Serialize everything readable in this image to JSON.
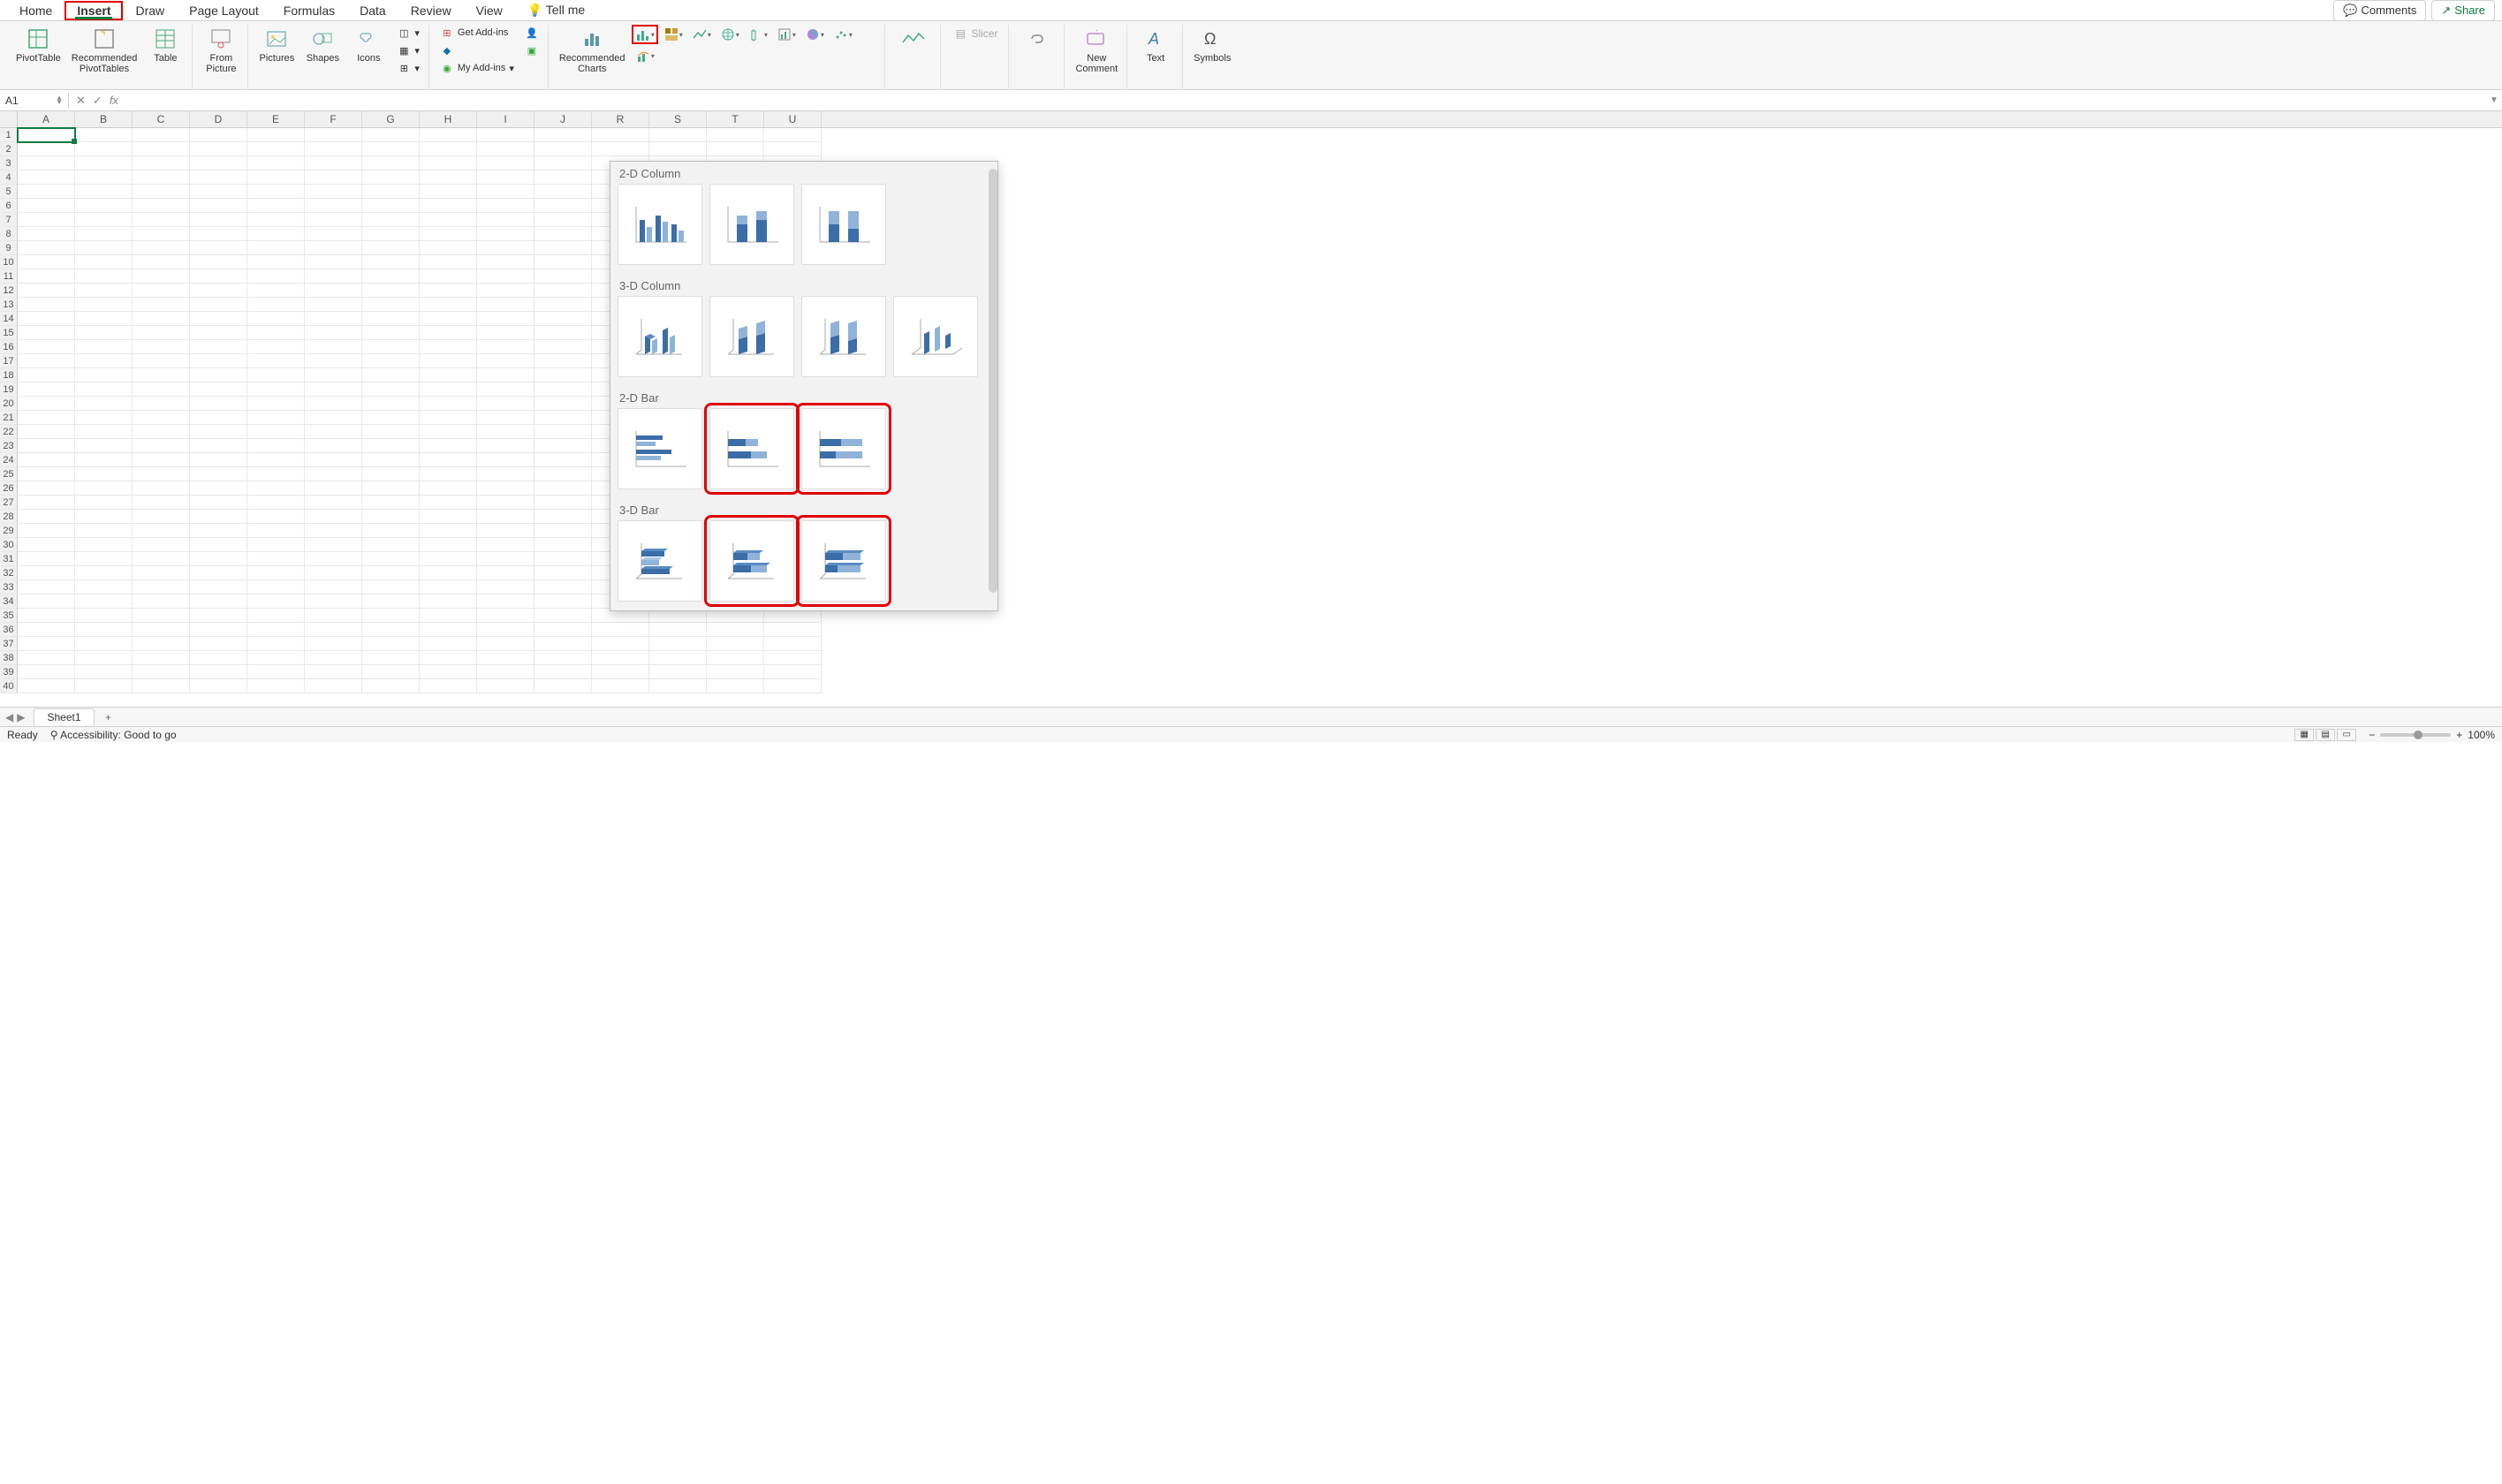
{
  "tabs": {
    "home": "Home",
    "insert": "Insert",
    "draw": "Draw",
    "page_layout": "Page Layout",
    "formulas": "Formulas",
    "data": "Data",
    "review": "Review",
    "view": "View",
    "tell_me": "Tell me"
  },
  "top_right": {
    "comments": "Comments",
    "share": "Share"
  },
  "ribbon": {
    "pivot_table": "PivotTable",
    "rec_pivot": "Recommended\nPivotTables",
    "table": "Table",
    "from_picture": "From\nPicture",
    "pictures": "Pictures",
    "shapes": "Shapes",
    "icons": "Icons",
    "get_addins": "Get Add-ins",
    "my_addins": "My Add-ins",
    "rec_charts": "Recommended\nCharts",
    "slicer": "Slicer",
    "new_comment": "New\nComment",
    "text": "Text",
    "symbols": "Symbols"
  },
  "name_box": "A1",
  "chart_popup": {
    "col_2d": "2-D Column",
    "col_3d": "3-D Column",
    "bar_2d": "2-D Bar",
    "bar_3d": "3-D Bar"
  },
  "columns": [
    "A",
    "B",
    "C",
    "D",
    "E",
    "F",
    "G",
    "H",
    "I",
    "J",
    "R",
    "S",
    "T",
    "U"
  ],
  "sheet": {
    "name": "Sheet1"
  },
  "status": {
    "ready": "Ready",
    "accessibility": "Accessibility: Good to go",
    "zoom": "100%"
  },
  "selected_cell": "A1",
  "row_count": 40
}
